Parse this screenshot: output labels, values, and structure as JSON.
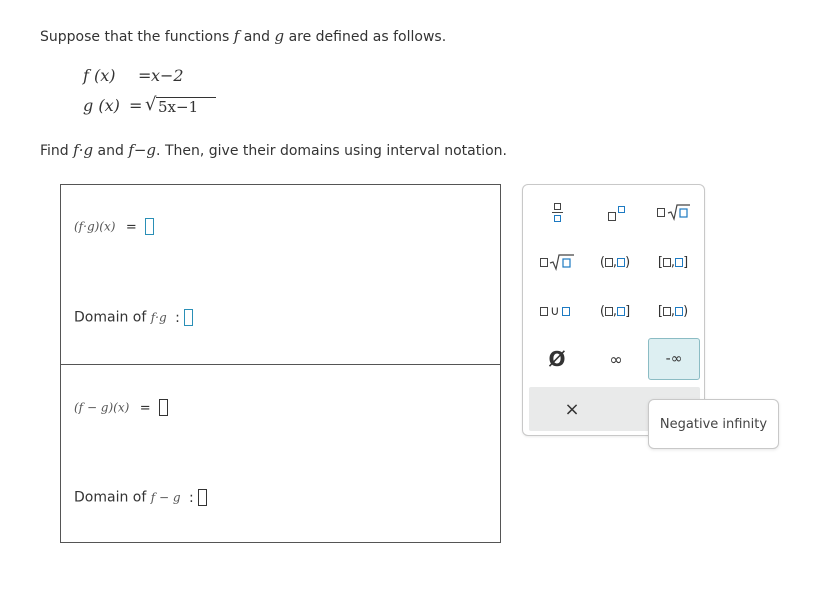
{
  "problem": {
    "intro": "Suppose that the functions f and g are defined as follows.",
    "intro_parts": [
      "Suppose that the functions ",
      "f",
      " and ",
      "g",
      " are defined as follows."
    ],
    "f_def": {
      "lhs": "f (x)",
      "eq": "=",
      "rhs": "x−2"
    },
    "g_def": {
      "lhs": "g (x)",
      "eq": "=",
      "radicand": "5x−1"
    },
    "prompt_parts": [
      "Find ",
      "f·g",
      " and ",
      "f−g",
      ". Then, give their domains using interval notation."
    ]
  },
  "answers": {
    "product_expr": "(f·g)(x)",
    "product_eq": "=",
    "product_domain_label": "Domain of ",
    "product_domain_fn": "f·g",
    "difference_expr": "(f − g)(x)",
    "difference_eq": "=",
    "difference_domain_label": "Domain of ",
    "difference_domain_fn": "f − g",
    "colon": ":"
  },
  "palette": {
    "fraction": "fraction",
    "exponent": "exponent",
    "nth_root": "nth-root",
    "coef_sqrt": "coef-sqrt",
    "open_open": "(□,□)",
    "closed_closed": "[□,□]",
    "union": "□∪□",
    "open_closed": "(□,□]",
    "closed_open": "[□,□)",
    "empty_set": "Ø",
    "infinity": "∞",
    "neg_infinity": "-∞",
    "clear": "×"
  },
  "tooltip": {
    "text": "Negative infinity"
  },
  "colors": {
    "accent": "#1d7ac2",
    "highlight_bg": "#ddeff2",
    "highlight_border": "#8bbcc4"
  }
}
